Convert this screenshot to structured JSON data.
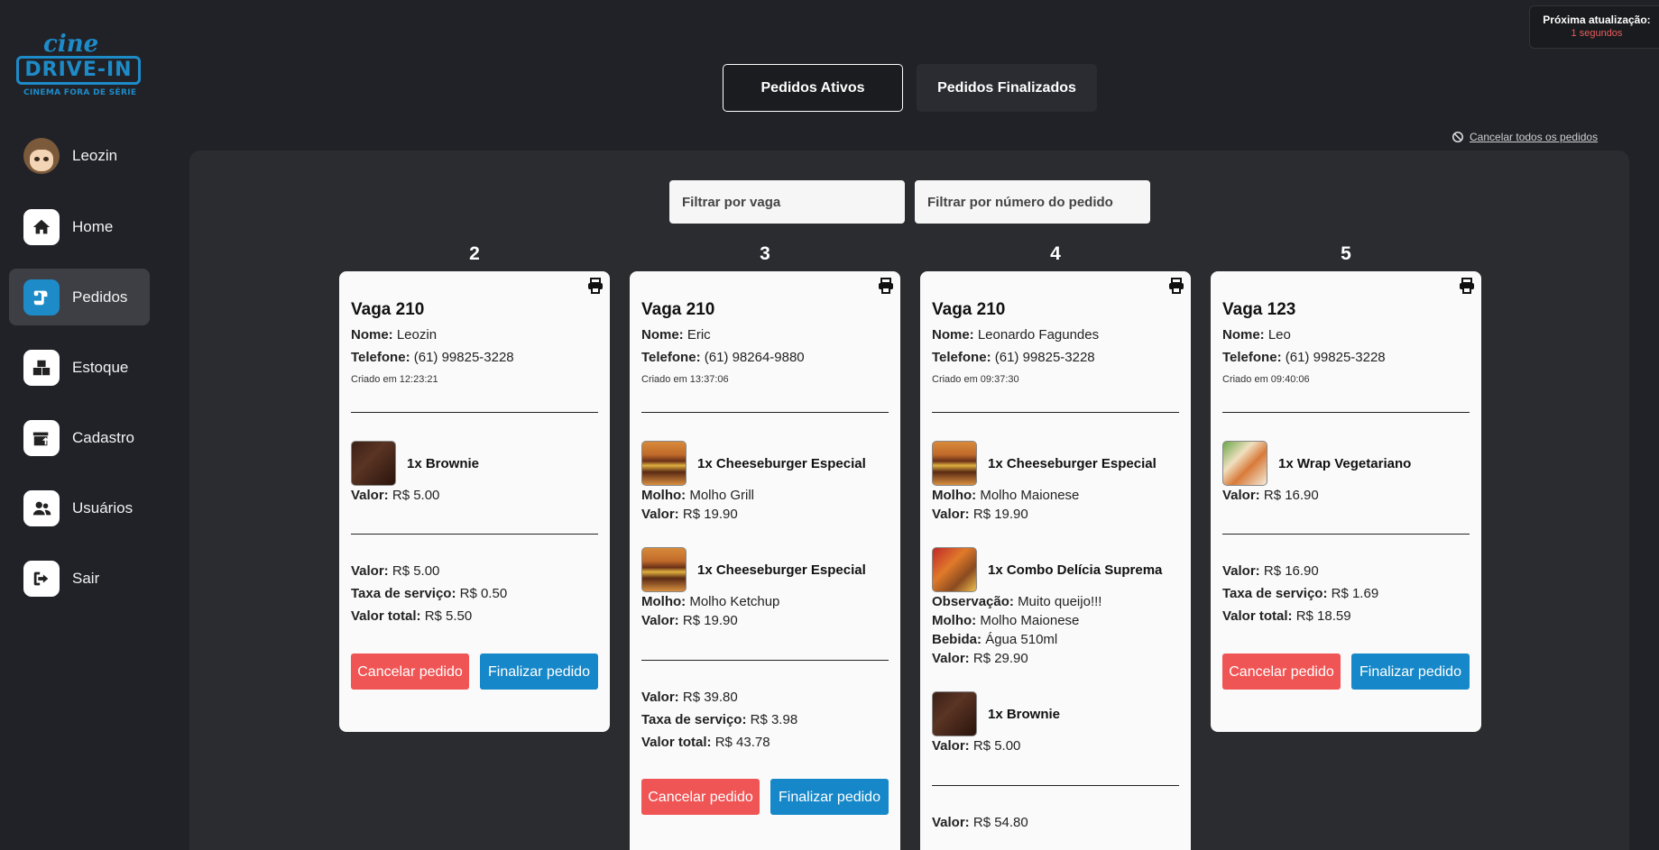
{
  "logo": {
    "cine": "cine",
    "drivein": "DRIVE-IN",
    "tagline": "CINEMA FORA DE SÉRIE"
  },
  "sidebar": {
    "user": "Leozin",
    "items": [
      {
        "label": "Home",
        "icon": "home-icon"
      },
      {
        "label": "Pedidos",
        "icon": "receipt-icon",
        "active": true
      },
      {
        "label": "Estoque",
        "icon": "boxes-icon"
      },
      {
        "label": "Cadastro",
        "icon": "box-upload-icon"
      },
      {
        "label": "Usuários",
        "icon": "users-icon"
      },
      {
        "label": "Sair",
        "icon": "logout-icon"
      }
    ]
  },
  "refresh": {
    "title": "Próxima atualização:",
    "value": "1 segundos"
  },
  "tabs": {
    "active": "Pedidos Ativos",
    "finished": "Pedidos Finalizados"
  },
  "cancel_all": "Cancelar todos os pedidos",
  "filters": {
    "vaga_placeholder": "Filtrar por vaga",
    "num_placeholder": "Filtrar por número do pedido"
  },
  "labels": {
    "nome": "Nome:",
    "telefone": "Telefone:",
    "valor": "Valor:",
    "molho": "Molho:",
    "observacao": "Observação:",
    "bebida": "Bebida:",
    "taxa": "Taxa de serviço:",
    "total": "Valor total:",
    "cancel_btn": "Cancelar pedido",
    "finish_btn": "Finalizar pedido"
  },
  "orders": [
    {
      "number": "2",
      "vaga": "Vaga 210",
      "nome": "Leozin",
      "telefone": "(61) 99825-3228",
      "criado": "Criado em 12:23:21",
      "items": [
        {
          "name": "1x Brownie",
          "img": "brownie",
          "valor": "R$ 5.00"
        }
      ],
      "valor": "R$ 5.00",
      "taxa": "R$ 0.50",
      "total": "R$ 5.50"
    },
    {
      "number": "3",
      "vaga": "Vaga 210",
      "nome": "Eric",
      "telefone": "(61) 98264-9880",
      "criado": "Criado em 13:37:06",
      "items": [
        {
          "name": "1x Cheeseburger Especial",
          "img": "burger",
          "molho": "Molho Grill",
          "valor": "R$ 19.90"
        },
        {
          "name": "1x Cheeseburger Especial",
          "img": "burger",
          "molho": "Molho Ketchup",
          "valor": "R$ 19.90"
        }
      ],
      "valor": "R$ 39.80",
      "taxa": "R$ 3.98",
      "total": "R$ 43.78"
    },
    {
      "number": "4",
      "vaga": "Vaga 210",
      "nome": "Leonardo Fagundes",
      "telefone": "(61) 99825-3228",
      "criado": "Criado em 09:37:30",
      "items": [
        {
          "name": "1x Cheeseburger Especial",
          "img": "burger",
          "molho": "Molho Maionese",
          "valor": "R$ 19.90"
        },
        {
          "name": "1x Combo Delícia Suprema",
          "img": "combo",
          "observacao": "Muito queijo!!!",
          "molho": "Molho Maionese",
          "bebida": "Água 510ml",
          "valor": "R$ 29.90"
        },
        {
          "name": "1x Brownie",
          "img": "brownie",
          "valor": "R$ 5.00"
        }
      ],
      "valor": "R$ 54.80"
    },
    {
      "number": "5",
      "vaga": "Vaga 123",
      "nome": "Leo",
      "telefone": "(61) 99825-3228",
      "criado": "Criado em 09:40:06",
      "items": [
        {
          "name": "1x Wrap Vegetariano",
          "img": "wrap",
          "valor": "R$ 16.90"
        }
      ],
      "valor": "R$ 16.90",
      "taxa": "R$ 1.69",
      "total": "R$ 18.59"
    }
  ]
}
